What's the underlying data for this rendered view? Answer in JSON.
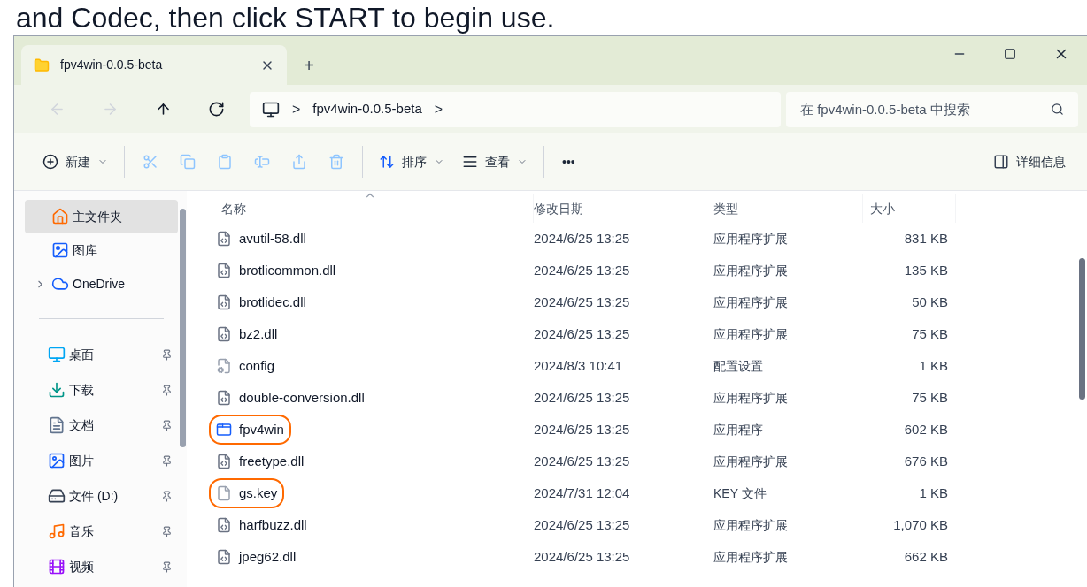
{
  "caption": "and Codec, then click START to begin use.",
  "window": {
    "tab": "fpv4win-0.0.5-beta",
    "new_tab": "+"
  },
  "nav": [
    {
      "kind": "back",
      "disabled": true
    },
    {
      "kind": "forward",
      "disabled": true
    },
    {
      "kind": "up",
      "disabled": false
    },
    {
      "kind": "refresh",
      "disabled": false
    }
  ],
  "breadcrumb": {
    "separator": ">",
    "items": [
      "fpv4win-0.0.5-beta"
    ]
  },
  "search": {
    "placeholder": "在 fpv4win-0.0.5-beta 中搜索"
  },
  "toolbar": {
    "actions": [
      {
        "kind": "new",
        "label": "新建",
        "disabled": false
      },
      {
        "kind": "cut",
        "disabled": true
      },
      {
        "kind": "copy",
        "disabled": true
      },
      {
        "kind": "paste",
        "disabled": true
      },
      {
        "kind": "rename",
        "disabled": true
      },
      {
        "kind": "share",
        "disabled": true
      },
      {
        "kind": "delete",
        "disabled": true
      },
      {
        "kind": "sort",
        "label": "排序",
        "disabled": false
      },
      {
        "kind": "view",
        "label": "查看",
        "disabled": false
      },
      {
        "kind": "more",
        "label": "•••",
        "disabled": false
      }
    ],
    "details": "详细信息"
  },
  "sidebar": {
    "top": [
      {
        "kind": "home",
        "label": "主文件夹",
        "selected": true
      },
      {
        "kind": "gallery",
        "label": "图库",
        "selected": false
      },
      {
        "kind": "onedrive",
        "label": "OneDrive",
        "selected": false
      }
    ],
    "pinned": [
      {
        "kind": "desktop",
        "label": "桌面",
        "selected": false
      },
      {
        "kind": "download",
        "label": "下载",
        "selected": false
      },
      {
        "kind": "documents",
        "label": "文档",
        "selected": false
      },
      {
        "kind": "pictures",
        "label": "图片",
        "selected": false
      },
      {
        "kind": "drive",
        "label": "文件 (D:)",
        "selected": false
      },
      {
        "kind": "music",
        "label": "音乐",
        "selected": false
      },
      {
        "kind": "videos",
        "label": "视频",
        "selected": false
      }
    ]
  },
  "table": {
    "columns": [
      "名称",
      "修改日期",
      "类型",
      "大小"
    ],
    "rows": [
      {
        "kind": "dll",
        "name": "avutil-58.dll",
        "date": "2024/6/25 13:25",
        "type": "应用程序扩展",
        "size": "831 KB",
        "highlighted": false
      },
      {
        "kind": "dll",
        "name": "brotlicommon.dll",
        "date": "2024/6/25 13:25",
        "type": "应用程序扩展",
        "size": "135 KB",
        "highlighted": false
      },
      {
        "kind": "dll",
        "name": "brotlidec.dll",
        "date": "2024/6/25 13:25",
        "type": "应用程序扩展",
        "size": "50 KB",
        "highlighted": false
      },
      {
        "kind": "dll",
        "name": "bz2.dll",
        "date": "2024/6/25 13:25",
        "type": "应用程序扩展",
        "size": "75 KB",
        "highlighted": false
      },
      {
        "kind": "config",
        "name": "config",
        "date": "2024/8/3 10:41",
        "type": "配置设置",
        "size": "1 KB",
        "highlighted": false
      },
      {
        "kind": "dll",
        "name": "double-conversion.dll",
        "date": "2024/6/25 13:25",
        "type": "应用程序扩展",
        "size": "75 KB",
        "highlighted": false
      },
      {
        "kind": "exe",
        "name": "fpv4win",
        "date": "2024/6/25 13:25",
        "type": "应用程序",
        "size": "602 KB",
        "highlighted": true
      },
      {
        "kind": "dll",
        "name": "freetype.dll",
        "date": "2024/6/25 13:25",
        "type": "应用程序扩展",
        "size": "676 KB",
        "highlighted": false
      },
      {
        "kind": "file",
        "name": "gs.key",
        "date": "2024/7/31 12:04",
        "type": "KEY 文件",
        "size": "1 KB",
        "highlighted": true
      },
      {
        "kind": "dll",
        "name": "harfbuzz.dll",
        "date": "2024/6/25 13:25",
        "type": "应用程序扩展",
        "size": "1,070 KB",
        "highlighted": false
      },
      {
        "kind": "dll",
        "name": "jpeg62.dll",
        "date": "2024/6/25 13:25",
        "type": "应用程序扩展",
        "size": "662 KB",
        "highlighted": false
      }
    ]
  }
}
